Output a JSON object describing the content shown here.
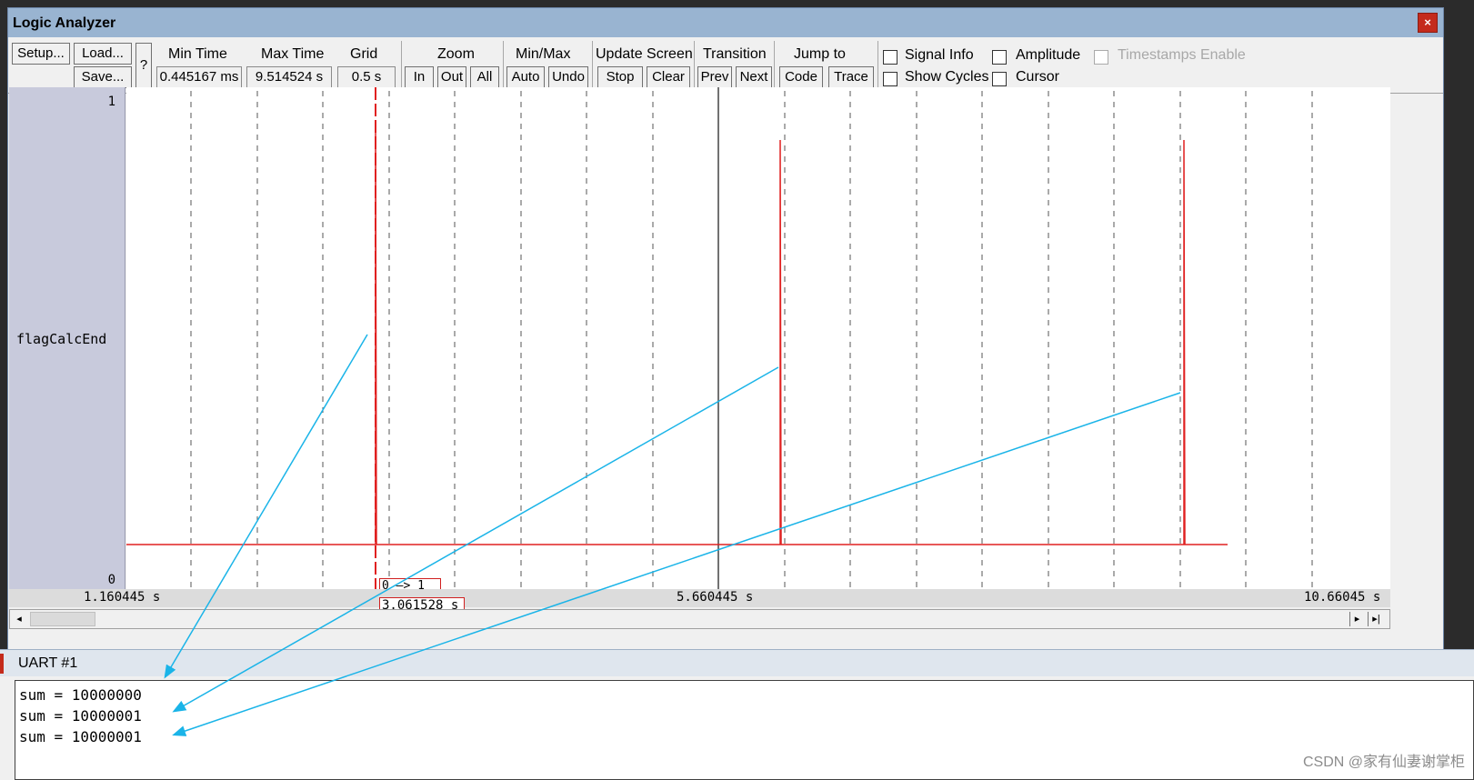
{
  "window": {
    "title": "Logic Analyzer",
    "close_glyph": "×"
  },
  "toolbar": {
    "setup": "Setup...",
    "load": "Load...",
    "save": "Save...",
    "help": "?",
    "min_time_label": "Min Time",
    "min_time_value": "0.445167 ms",
    "max_time_label": "Max Time",
    "max_time_value": "9.514524 s",
    "grid_label": "Grid",
    "grid_value": "0.5 s",
    "zoom_label": "Zoom",
    "zoom_in": "In",
    "zoom_out": "Out",
    "zoom_all": "All",
    "minmax_label": "Min/Max",
    "minmax_auto": "Auto",
    "minmax_undo": "Undo",
    "update_label": "Update Screen",
    "update_stop": "Stop",
    "update_clear": "Clear",
    "transition_label": "Transition",
    "transition_prev": "Prev",
    "transition_next": "Next",
    "jump_label": "Jump to",
    "jump_code": "Code",
    "jump_trace": "Trace",
    "signal_info": "Signal Info",
    "show_cycles": "Show Cycles",
    "amplitude": "Amplitude",
    "cursor": "Cursor",
    "timestamps": "Timestamps Enable"
  },
  "signal": {
    "name": "flagCalcEnd",
    "y_max": "1",
    "y_min": "0"
  },
  "axis": {
    "t_start": "1.160445 s",
    "t_mid": "5.660445 s",
    "t_end": "10.66045 s",
    "cursor_time": "3.061528 s",
    "transition_label": "0 —> 1"
  },
  "uart": {
    "title": "UART #1",
    "lines": [
      "sum = 10000000",
      "sum = 10000001",
      "sum = 10000001"
    ]
  },
  "watermark": "CSDN @家有仙妻谢掌柜",
  "colors": {
    "signal": "#e02020",
    "annotation": "#1ab4e8",
    "grid": "#555555"
  }
}
